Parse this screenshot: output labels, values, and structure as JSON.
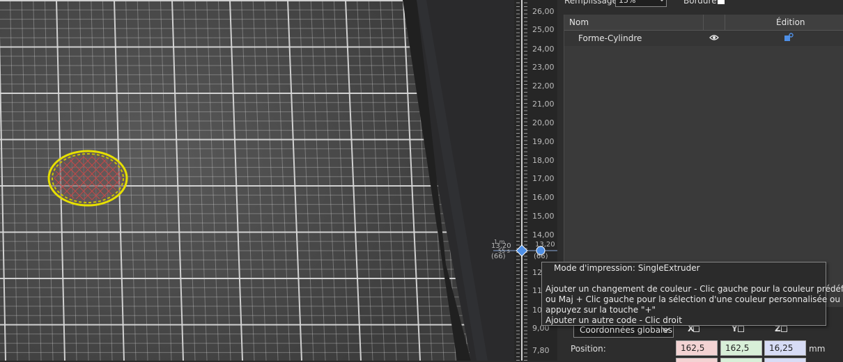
{
  "toolbar": {
    "fill_label": "Remplissage:",
    "fill_value": "15%",
    "border_label": "Bordure:"
  },
  "layer_slider": {
    "ticks": [
      "26,00",
      "25,00",
      "24,00",
      "23,00",
      "22,00",
      "21,00",
      "20,00",
      "19,00",
      "18,00",
      "17,00",
      "16,00",
      "15,00",
      "14,00",
      "13,20",
      "12,",
      "11,",
      "10,",
      "9,00",
      "7,80"
    ],
    "thumb_left_value": "13,20",
    "thumb_left_count": "(66)",
    "thumb_left_small_1": "1 m",
    "thumb_left_small_2": "55 s",
    "thumb_right_value": "13,20",
    "thumb_right_count": "(66)",
    "accent": "#4e8fe6"
  },
  "object_list": {
    "col_name": "Nom",
    "col_edit": "Édition",
    "rows": [
      {
        "name": "Forme-Cylindre",
        "visible_icon": "eye-icon",
        "edit_icon": "edit-settings-icon"
      }
    ]
  },
  "tooltip": {
    "mode": "Mode d'impression: SingleExtruder",
    "lines": [
      "Ajouter un changement de couleur - Clic gauche pour la couleur prédéfinie",
      "ou Maj + Clic gauche pour la sélection d'une couleur personnalisée ou",
      "appuyez sur la touche \"+\"",
      "Ajouter un autre code - Clic droit"
    ]
  },
  "coordinates": {
    "system": "Coordonnées globales",
    "x_label": "X",
    "y_label": "Y",
    "z_label": "Z",
    "position_label": "Position:",
    "x": "162,5",
    "y": "162,5",
    "z": "16,25",
    "unit": "mm",
    "x_color": "#f3d3d3",
    "y_color": "#d8efd8",
    "z_color": "#d7dcf5"
  },
  "colors": {
    "bed": "#4a4a4a",
    "grid": "#d8d8d8",
    "object_outline": "#e6e000",
    "infill": "#d04848"
  }
}
